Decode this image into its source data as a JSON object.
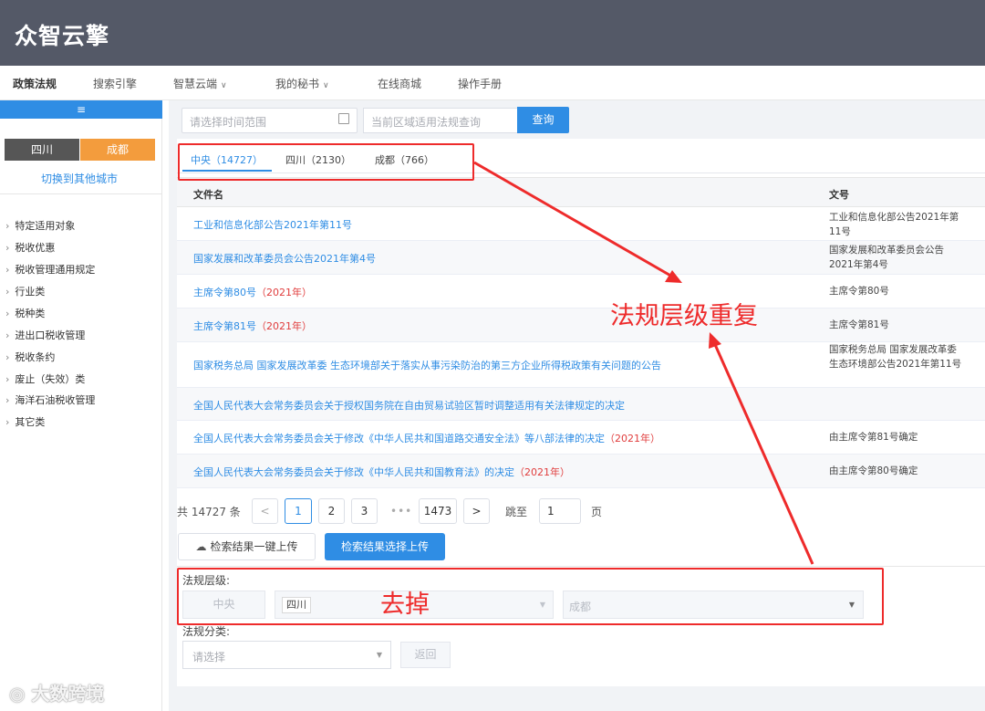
{
  "header": {
    "logo": "众智云擎"
  },
  "nav": {
    "items": [
      "政策法规",
      "搜索引擎",
      "智慧云端",
      "我的秘书",
      "在线商城",
      "操作手册"
    ]
  },
  "sidebar": {
    "toggle_icon": "menu-icon",
    "province": "四川",
    "city": "成都",
    "switch_label": "切换到其他城市",
    "categories": [
      "特定适用对象",
      "税收优惠",
      "税收管理通用规定",
      "行业类",
      "税种类",
      "进出口税收管理",
      "税收条约",
      "废止（失效）类",
      "海洋石油税收管理",
      "其它类"
    ]
  },
  "search": {
    "date_placeholder": "请选择时间范围",
    "query_placeholder": "当前区域适用法规查询",
    "query_button": "查询"
  },
  "tabs": [
    "中央（14727）",
    "四川（2130）",
    "成都（766）"
  ],
  "table": {
    "headers": {
      "name": "文件名",
      "no": "文号"
    },
    "rows": [
      {
        "name": "工业和信息化部公告2021年第11号",
        "year": "",
        "no": "工业和信息化部公告2021年第11号"
      },
      {
        "name": "国家发展和改革委员会公告2021年第4号",
        "year": "",
        "no": "国家发展和改革委员会公告2021年第4号"
      },
      {
        "name": "主席令第80号",
        "year": "（2021年）",
        "no": "主席令第80号"
      },
      {
        "name": "主席令第81号",
        "year": "（2021年）",
        "no": "主席令第81号"
      },
      {
        "name": "国家税务总局 国家发展改革委 生态环境部关于落实从事污染防治的第三方企业所得税政策有关问题的公告",
        "year": "",
        "no": "国家税务总局 国家发展改革委 生态环境部公告2021年第11号"
      },
      {
        "name": "全国人民代表大会常务委员会关于授权国务院在自由贸易试验区暂时调整适用有关法律规定的决定",
        "year": "",
        "no": ""
      },
      {
        "name": "全国人民代表大会常务委员会关于修改《中华人民共和国道路交通安全法》等八部法律的决定",
        "year": "（2021年）",
        "no": "由主席令第81号确定"
      },
      {
        "name": "全国人民代表大会常务委员会关于修改《中华人民共和国教育法》的决定",
        "year": "（2021年）",
        "no": "由主席令第80号确定"
      }
    ]
  },
  "pagination": {
    "total": "共 14727 条",
    "prev": "<",
    "pages": [
      "1",
      "2",
      "3"
    ],
    "ellipsis": "•••",
    "last": "1473",
    "next": ">",
    "jump_label": "跳至",
    "jump_value": "1",
    "page_suffix": "页"
  },
  "actions": {
    "upload_all": "检索结果一键上传",
    "upload_selected": "检索结果选择上传"
  },
  "filters": {
    "level_label": "法规层级:",
    "central": "中央",
    "province_tag": "四川",
    "city_placeholder": "成都",
    "category_label": "法规分类:",
    "category_placeholder": "请选择",
    "back": "返回"
  },
  "annotations": {
    "duplicate": "法规层级重复",
    "remove": "去掉",
    "color": "#ee2b2b"
  },
  "watermark": "大数跨境"
}
